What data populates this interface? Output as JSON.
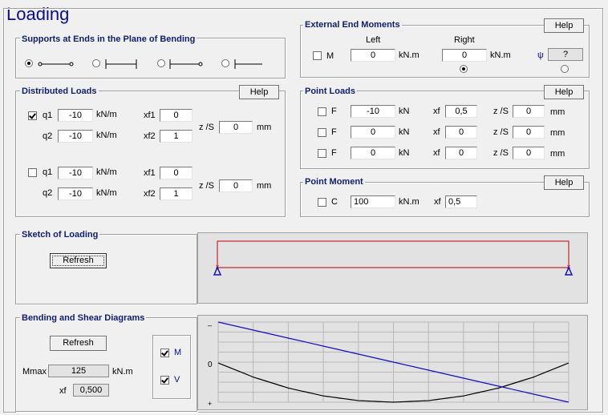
{
  "title": "Loading",
  "supports": {
    "title": "Supports at Ends in the Plane of Bending",
    "selected_index": 0
  },
  "distributed": {
    "title": "Distributed Loads",
    "help": "Help",
    "set1": {
      "checked": true,
      "q1_label": "q1",
      "q1": "-10",
      "q2_label": "q2",
      "q2": "-10",
      "unit": "kN/m",
      "xf1_label": "xf1",
      "xf1": "0",
      "xf2_label": "xf2",
      "xf2": "1",
      "zs_label": "z /S",
      "zs": "0",
      "zs_unit": "mm"
    },
    "set2": {
      "checked": false,
      "q1_label": "q1",
      "q1": "-10",
      "q2_label": "q2",
      "q2": "-10",
      "unit": "kN/m",
      "xf1_label": "xf1",
      "xf1": "0",
      "xf2_label": "xf2",
      "xf2": "1",
      "zs_label": "z /S",
      "zs": "0",
      "zs_unit": "mm"
    }
  },
  "end_moments": {
    "title": "External End Moments",
    "help": "Help",
    "left_label": "Left",
    "right_label": "Right",
    "m_label": "M",
    "left_value": "0",
    "right_value": "0",
    "unit": "kN.m",
    "psi_symbol": "ψ",
    "psi_value": "?",
    "selected": "right"
  },
  "point_loads": {
    "title": "Point Loads",
    "help": "Help",
    "rows": [
      {
        "label": "F",
        "value": "-10",
        "unit": "kN",
        "xf_label": "xf",
        "xf": "0,5",
        "zs_label": "z /S",
        "zs": "0",
        "zs_unit": "mm"
      },
      {
        "label": "F",
        "value": "0",
        "unit": "kN",
        "xf_label": "xf",
        "xf": "0",
        "zs_label": "z /S",
        "zs": "0",
        "zs_unit": "mm"
      },
      {
        "label": "F",
        "value": "0",
        "unit": "kN",
        "xf_label": "xf",
        "xf": "0",
        "zs_label": "z /S",
        "zs": "0",
        "zs_unit": "mm"
      }
    ]
  },
  "point_moment": {
    "title": "Point Moment",
    "help": "Help",
    "label": "C",
    "value": "100",
    "unit": "kN.m",
    "xf_label": "xf",
    "xf": "0,5"
  },
  "sketch": {
    "title": "Sketch of Loading",
    "refresh": "Refresh"
  },
  "diagrams": {
    "title": "Bending and Shear Diagrams",
    "refresh": "Refresh",
    "m_label": "M",
    "v_label": "V",
    "m_checked": true,
    "v_checked": true,
    "mmax_label": "Mmax",
    "mmax": "125",
    "mmax_unit": "kN.m",
    "xf_label": "xf",
    "xf": "0,500",
    "y_top": "–",
    "y_zero": "0",
    "y_bottom": "+",
    "colors": {
      "moment": "#000000",
      "shear": "#1010c8"
    }
  },
  "chart_data": {
    "type": "line",
    "x": [
      0,
      0.1,
      0.2,
      0.3,
      0.4,
      0.5,
      0.6,
      0.7,
      0.8,
      0.9,
      1.0
    ],
    "series": [
      {
        "name": "M",
        "values": [
          0,
          -45,
          -80,
          -105,
          -120,
          -125,
          -120,
          -105,
          -80,
          -45,
          0
        ]
      },
      {
        "name": "V",
        "values": [
          50,
          40,
          30,
          20,
          10,
          0,
          -10,
          -20,
          -30,
          -40,
          -50
        ]
      }
    ],
    "grid": true,
    "xlim": [
      0,
      1
    ],
    "y_axis_inverted": true
  }
}
